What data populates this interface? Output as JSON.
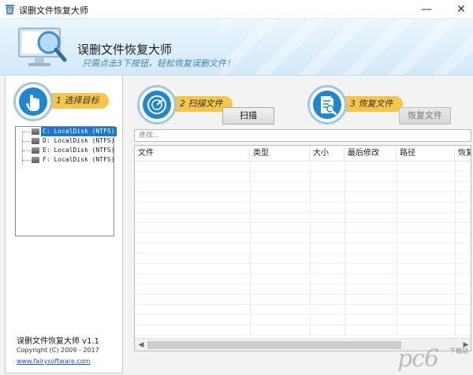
{
  "window": {
    "title": "误删文件恢复大师",
    "icon": "recycle-bin-icon",
    "minimize_glyph": "—",
    "close_glyph": "✕"
  },
  "banner": {
    "app_title": "误删文件恢复大师",
    "slogan": "只需点击3下按钮，轻松恢复误删文件！",
    "logo": "monitor-magnifier-icon"
  },
  "steps": {
    "select": {
      "label": "1 选择目标",
      "icon": "hand-pointer-icon"
    },
    "scan": {
      "label": "2 扫描文件",
      "icon": "radar-scan-icon",
      "button": "扫描"
    },
    "recover": {
      "label": "3 恢复文件",
      "icon": "document-search-icon",
      "button": "恢复文件"
    }
  },
  "drives": [
    {
      "label": "C: LocalDisk (NTFS)",
      "selected": true
    },
    {
      "label": "D: LocalDisk (NTFS)",
      "selected": false
    },
    {
      "label": "E: LocalDisk (NTFS)",
      "selected": false
    },
    {
      "label": "F: LocalDisk (NTFS)",
      "selected": false
    }
  ],
  "filter": {
    "placeholder": "查找..."
  },
  "table": {
    "columns": [
      "文件",
      "类型",
      "大小",
      "最后修改",
      "路径",
      "恢复"
    ]
  },
  "footer": {
    "version": "误删文件恢复大师 v1.1",
    "copyright": "Copyright (C) 2009 - 2017",
    "website": "www.fairysoftware.com"
  },
  "watermark": {
    "text": "pc6",
    "sub": "下载站"
  },
  "colors": {
    "accent_blue": "#1e86d2",
    "step_pill": "#f6c64a",
    "selection": "#1877d6",
    "link": "#1a4fd6"
  }
}
